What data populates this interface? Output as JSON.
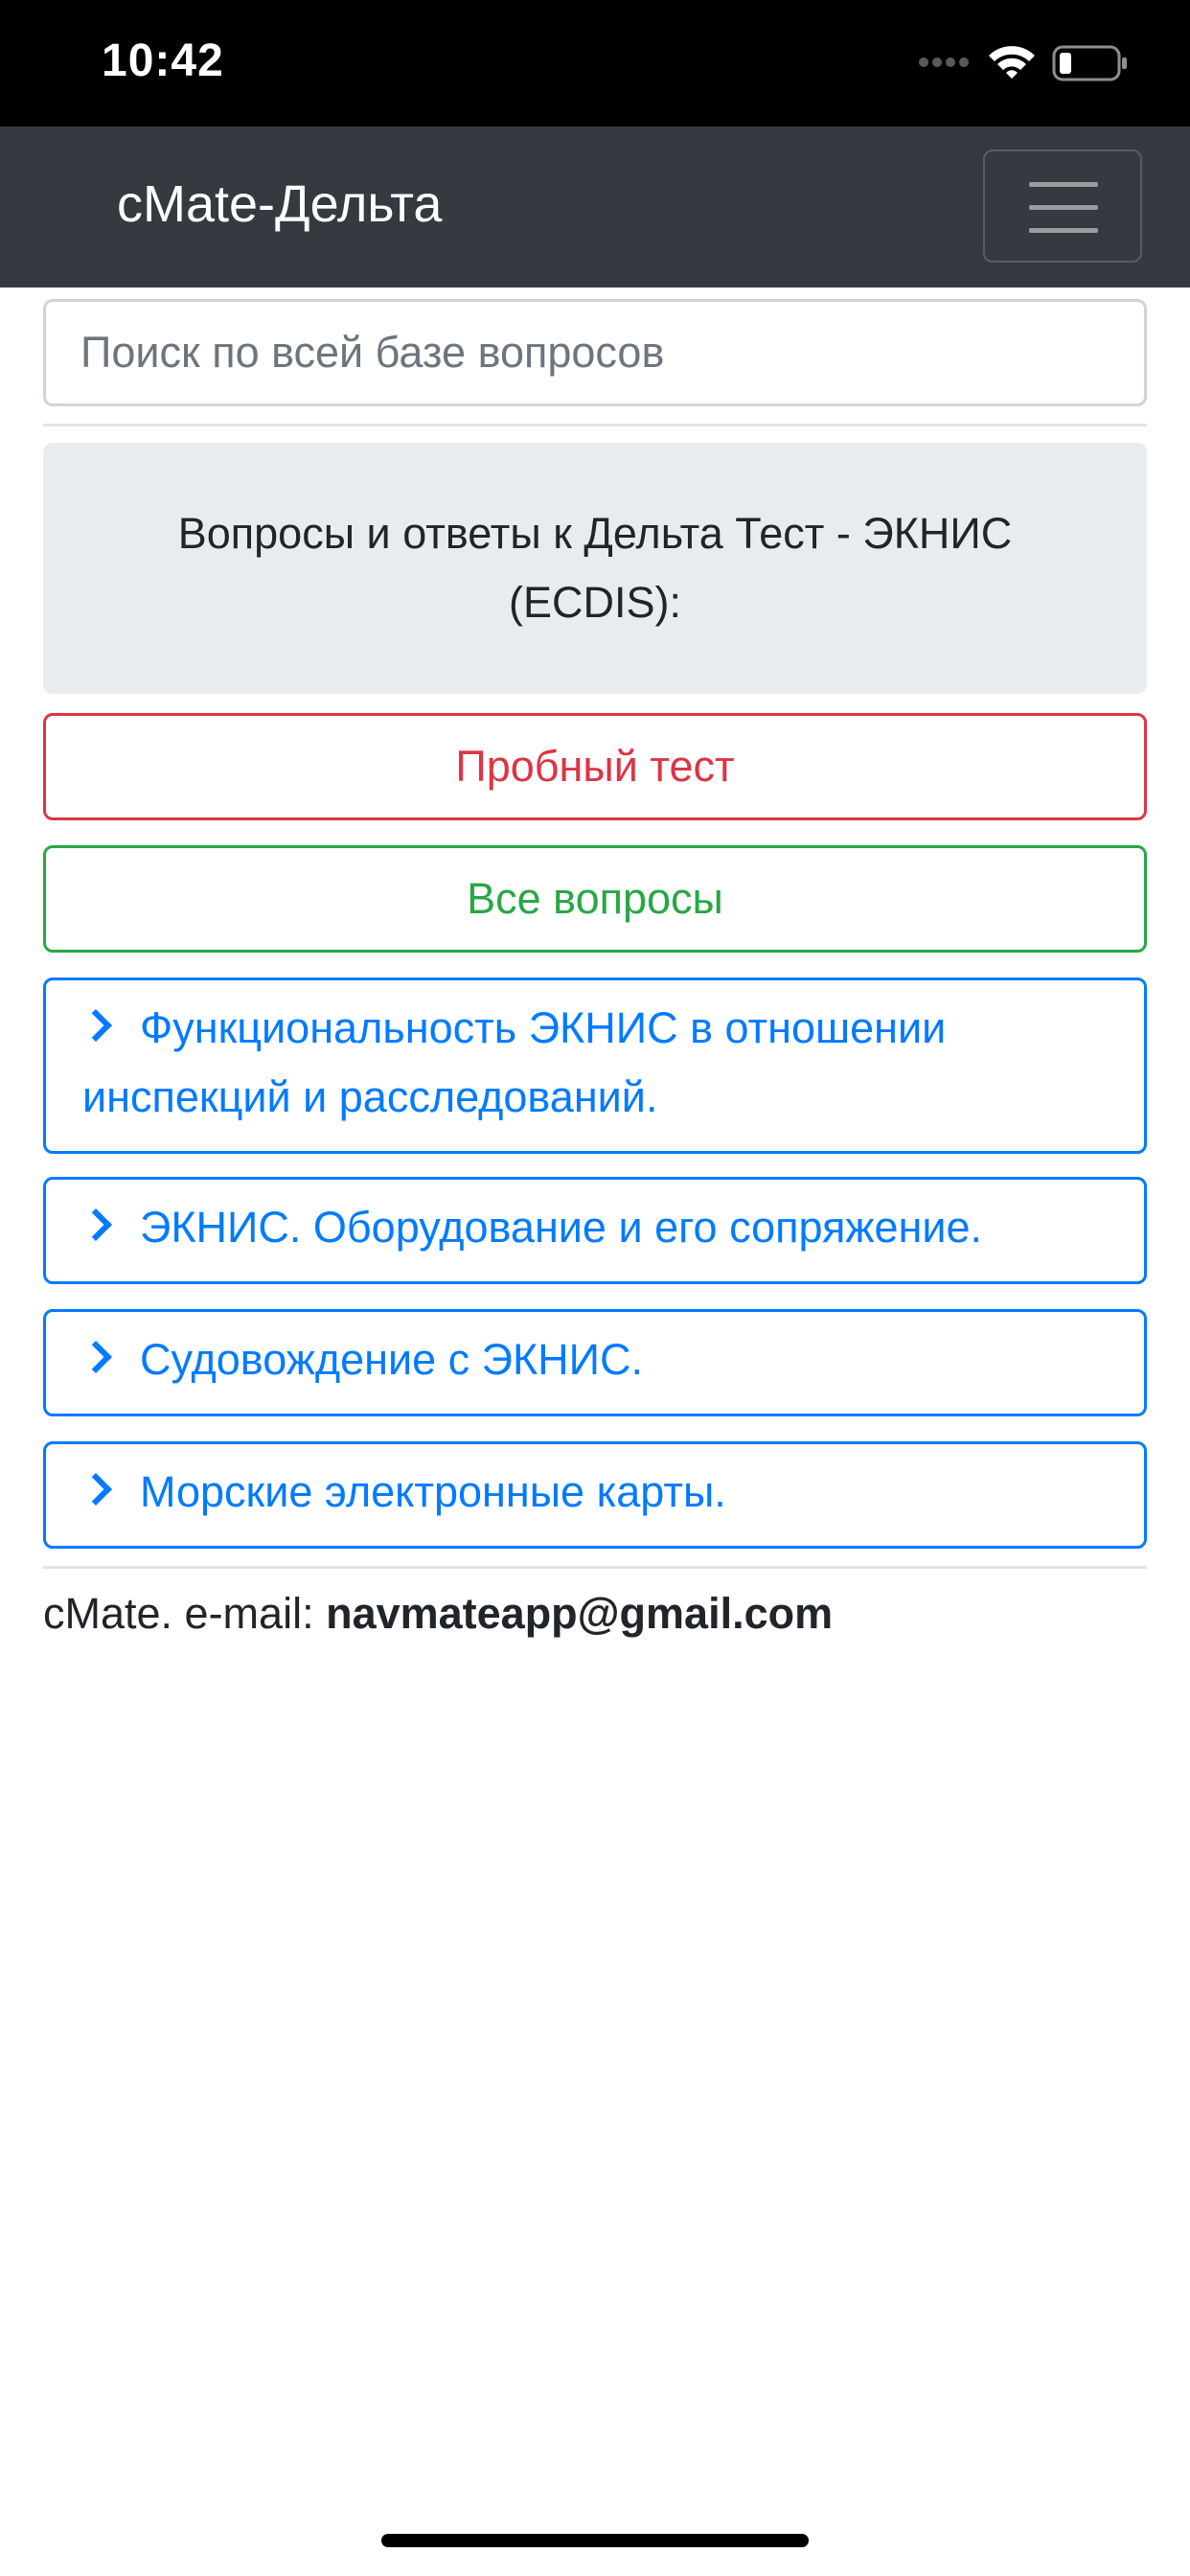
{
  "status_bar": {
    "time": "10:42"
  },
  "navbar": {
    "brand": "cMate-Дельта",
    "menu_icon": "hamburger-icon"
  },
  "search": {
    "placeholder": "Поиск по всей базе вопросов"
  },
  "info_panel": {
    "text": "Вопросы и ответы к Дельта Тест - ЭКНИС (ECDIS):"
  },
  "buttons": {
    "trial_test": "Пробный тест",
    "all_questions": "Все вопросы"
  },
  "topics": [
    {
      "label": "Функциональность ЭКНИС в отношении инспекций и расследований."
    },
    {
      "label": "ЭКНИС. Оборудование и его сопряжение."
    },
    {
      "label": "Судовождение с ЭКНИС."
    },
    {
      "label": "Морские электронные карты."
    }
  ],
  "footer": {
    "prefix": "cMate. e-mail: ",
    "email": "navmateapp@gmail.com"
  },
  "colors": {
    "navbar_bg": "#343a40",
    "danger": "#dc3545",
    "success": "#28a745",
    "primary": "#007bff",
    "panel_bg": "#e9ecef"
  }
}
